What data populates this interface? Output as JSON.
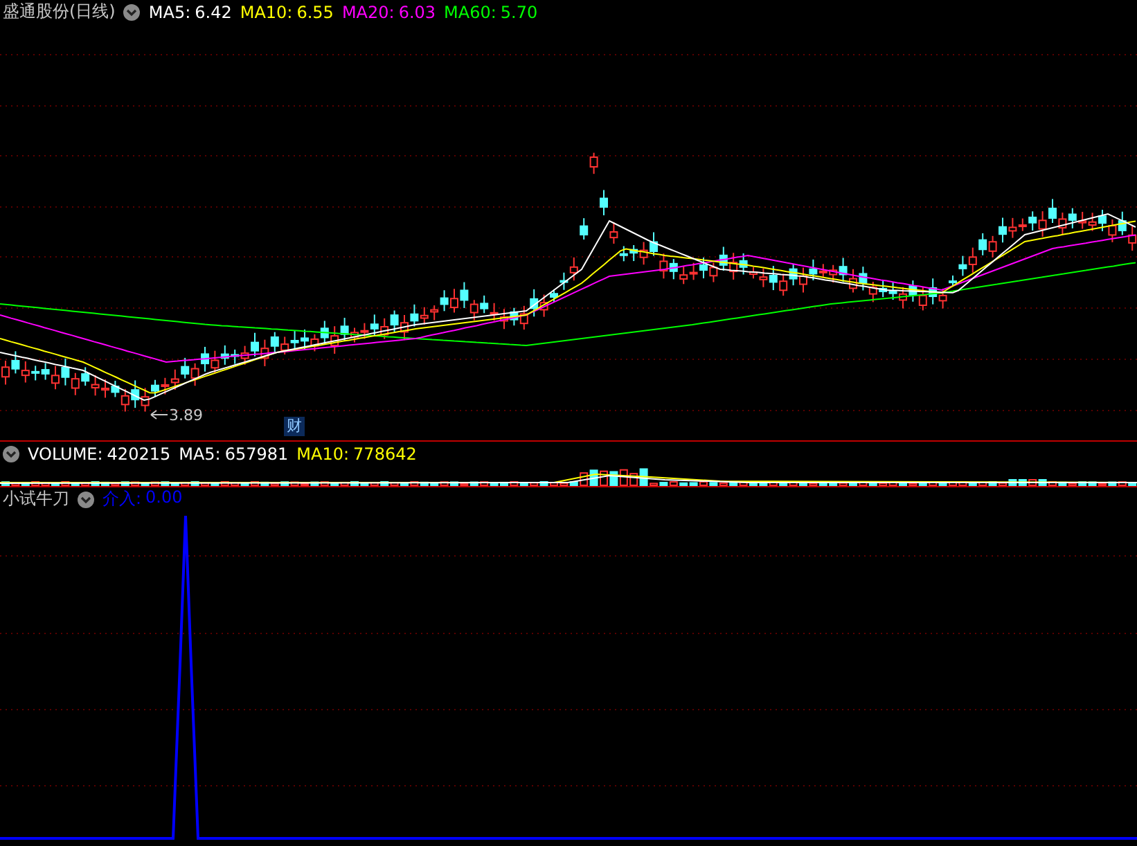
{
  "price_panel": {
    "title": "盛通股份(日线)",
    "indicators": [
      {
        "label": "MA5:",
        "value": "6.42",
        "color": "#ffffff"
      },
      {
        "label": "MA10:",
        "value": "6.55",
        "color": "#ffff00"
      },
      {
        "label": "MA20:",
        "value": "6.03",
        "color": "#ff00ff"
      },
      {
        "label": "MA60:",
        "value": "5.70",
        "color": "#00ff00"
      }
    ],
    "low_marker": "3.89",
    "event_badge": "财"
  },
  "volume_panel": {
    "indicators": [
      {
        "label": "VOLUME:",
        "value": "420215",
        "color": "#ffffff"
      },
      {
        "label": "MA5:",
        "value": "657981",
        "color": "#ffffff"
      },
      {
        "label": "MA10:",
        "value": "778642",
        "color": "#ffff00"
      }
    ]
  },
  "indicator_panel": {
    "title": "小试牛刀",
    "indicators": [
      {
        "label": "介入:",
        "value": "0.00",
        "color": "#0000ff"
      }
    ]
  }
}
